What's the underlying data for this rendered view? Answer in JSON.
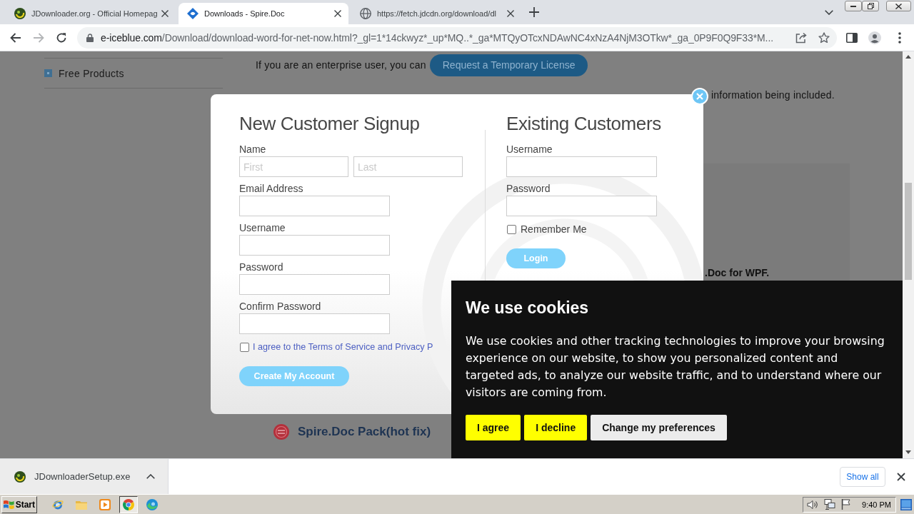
{
  "browser": {
    "tabs": [
      {
        "title": "JDownloader.org - Official Homepag",
        "selected": false
      },
      {
        "title": "Downloads - Spire.Doc",
        "selected": true
      },
      {
        "title": "https://fetch.jdcdn.org/download/dl",
        "selected": false
      }
    ],
    "address_bar": {
      "host": "e-iceblue.com",
      "path": "/Download/download-word-for-net-now.html?_gl=1*14ckwyz*_up*MQ..*_ga*MTQyOTcxNDAwNC4xNzA4NjM3OTkw*_ga_0P9F0Q9F33*M..."
    }
  },
  "page": {
    "sidebar": {
      "items": [
        {
          "label": "Free Products"
        }
      ]
    },
    "license_line": {
      "text": "If you are an enterprise user, you can",
      "button": "Request a Temporary License"
    },
    "email_line_end": "information being included.",
    "product_caption": ".Doc for WPF.",
    "hotfix_title": "Spire.Doc Pack(hot fix)"
  },
  "signup_dialog": {
    "new_customer": {
      "title": "New Customer Signup",
      "fields": [
        {
          "label": "Name",
          "placeholders": [
            "First",
            "Last"
          ]
        },
        {
          "label": "Email Address"
        },
        {
          "label": "Username"
        },
        {
          "label": "Password"
        },
        {
          "label": "Confirm Password"
        }
      ],
      "terms": {
        "label": "I agree to the Terms of Service and Privacy P",
        "checked": false
      },
      "submit": "Create My Account"
    },
    "existing_customers": {
      "title": "Existing Customers",
      "fields": [
        {
          "label": "Username"
        },
        {
          "label": "Password"
        }
      ],
      "remember": {
        "label": "Remember Me",
        "checked": false
      },
      "submit": "Login"
    }
  },
  "cookie_banner": {
    "title": "We use cookies",
    "text": "We use cookies and other tracking technologies to improve your browsing experience on our website, to show you personalized content and targeted ads, to analyze our website traffic, and to understand where our visitors are coming from.",
    "buttons": [
      {
        "label": "I agree",
        "kind": "primary"
      },
      {
        "label": "I decline",
        "kind": "primary"
      },
      {
        "label": "Change my preferences",
        "kind": "secondary"
      }
    ]
  },
  "download_bar": {
    "items": [
      {
        "filename": "JDownloaderSetup.exe"
      }
    ],
    "show_all": "Show all"
  },
  "taskbar": {
    "start": "Start",
    "apps": [
      {
        "selected": false
      },
      {
        "selected": false
      },
      {
        "selected": false
      },
      {
        "selected": true
      },
      {
        "selected": false
      }
    ],
    "clock": "9:40 PM"
  }
}
